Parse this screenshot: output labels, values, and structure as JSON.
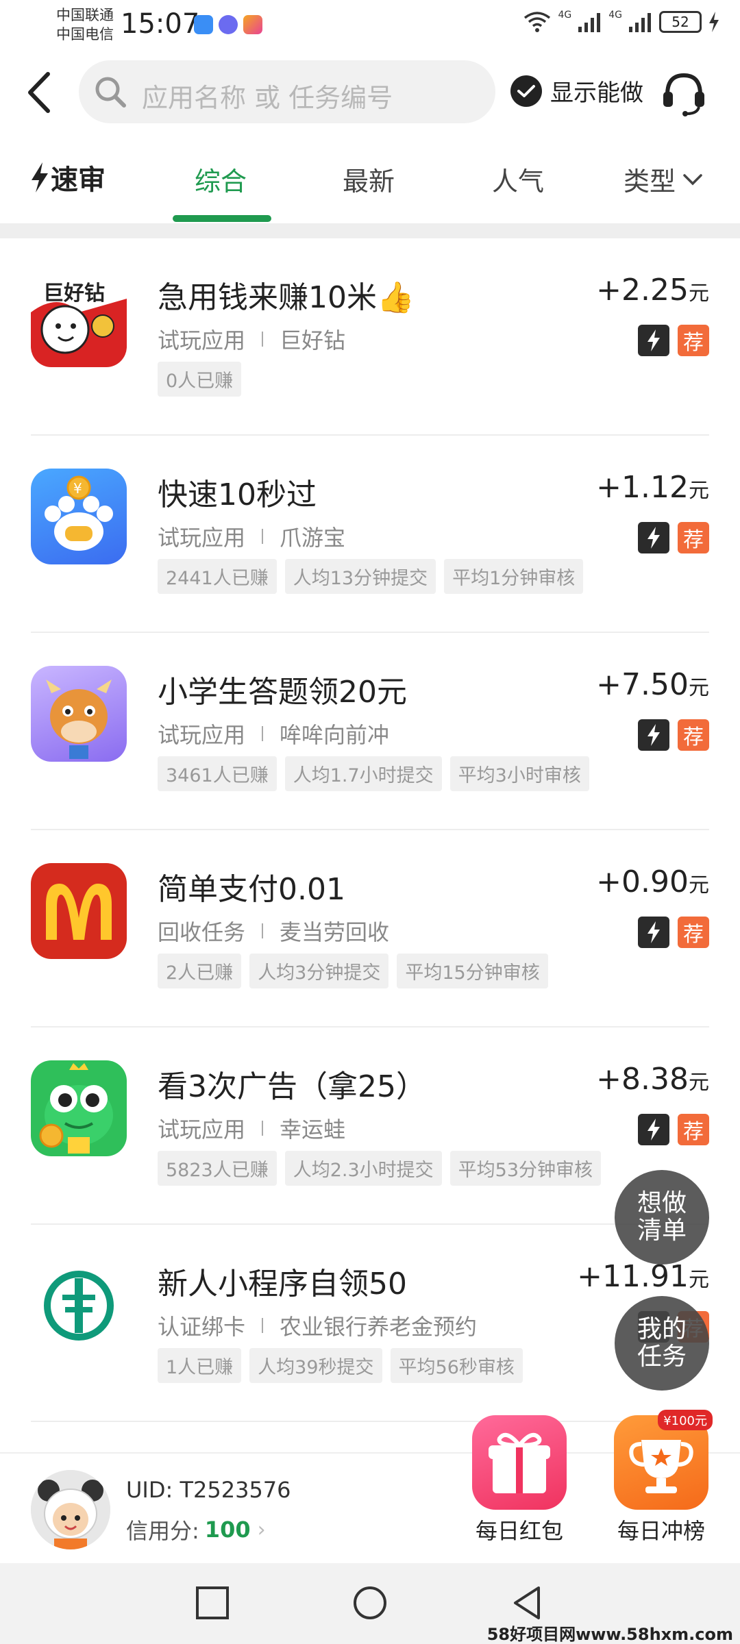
{
  "status_bar": {
    "carrier1": "中国联通",
    "carrier2": "中国电信",
    "time": "15:07",
    "net1": "4G",
    "net2": "4G",
    "battery": "52"
  },
  "header": {
    "search_placeholder": "应用名称 或 任务编号",
    "show_can_do": "显示能做"
  },
  "tabs": {
    "brand": "速审",
    "items": [
      "综合",
      "最新",
      "人气"
    ],
    "type_label": "类型",
    "active_index": 0
  },
  "tasks": [
    {
      "title": "急用钱来赚10米👍",
      "category": "试玩应用",
      "app": "巨好钻",
      "reward": "+2.25",
      "unit": "元",
      "tags": [
        "0人已赚"
      ],
      "icon": "juhaozuan-app-icon",
      "badge_rec": "荐"
    },
    {
      "title": "快速10秒过",
      "category": "试玩应用",
      "app": "爪游宝",
      "reward": "+1.12",
      "unit": "元",
      "tags": [
        "2441人已赚",
        "人均13分钟提交",
        "平均1分钟审核"
      ],
      "icon": "zhuayoubao-app-icon",
      "badge_rec": "荐"
    },
    {
      "title": "小学生答题领20元",
      "category": "试玩应用",
      "app": "哞哞向前冲",
      "reward": "+7.50",
      "unit": "元",
      "tags": [
        "3461人已赚",
        "人均1.7小时提交",
        "平均3小时审核"
      ],
      "icon": "moumou-app-icon",
      "badge_rec": "荐"
    },
    {
      "title": "简单支付0.01",
      "category": "回收任务",
      "app": "麦当劳回收",
      "reward": "+0.90",
      "unit": "元",
      "tags": [
        "2人已赚",
        "人均3分钟提交",
        "平均15分钟审核"
      ],
      "icon": "mcdonalds-app-icon",
      "badge_rec": "荐"
    },
    {
      "title": "看3次广告（拿25）",
      "category": "试玩应用",
      "app": "幸运蛙",
      "reward": "+8.38",
      "unit": "元",
      "tags": [
        "5823人已赚",
        "人均2.3小时提交",
        "平均53分钟审核"
      ],
      "icon": "lucky-frog-app-icon",
      "badge_rec": "荐"
    },
    {
      "title": "新人小程序自领50",
      "category": "认证绑卡",
      "app": "农业银行养老金预约",
      "reward": "+11.91",
      "unit": "元",
      "tags": [
        "1人已赚",
        "人均39秒提交",
        "平均56秒审核"
      ],
      "icon": "abc-bank-app-icon",
      "badge_rec": "荐"
    }
  ],
  "floating": {
    "want_line1": "想做",
    "want_line2": "清单",
    "mine_line1": "我的",
    "mine_line2": "任务"
  },
  "user": {
    "uid": "UID: T2523576",
    "credit_label": "信用分:",
    "credit_value": "100"
  },
  "promos": {
    "red_packet": "每日红包",
    "rank": "每日冲榜",
    "rank_badge": "¥100元"
  },
  "watermark": "58好项目网www.58hxm.com",
  "colors": {
    "accent_green": "#1f9a4f",
    "recommend_orange": "#f26b3a"
  }
}
